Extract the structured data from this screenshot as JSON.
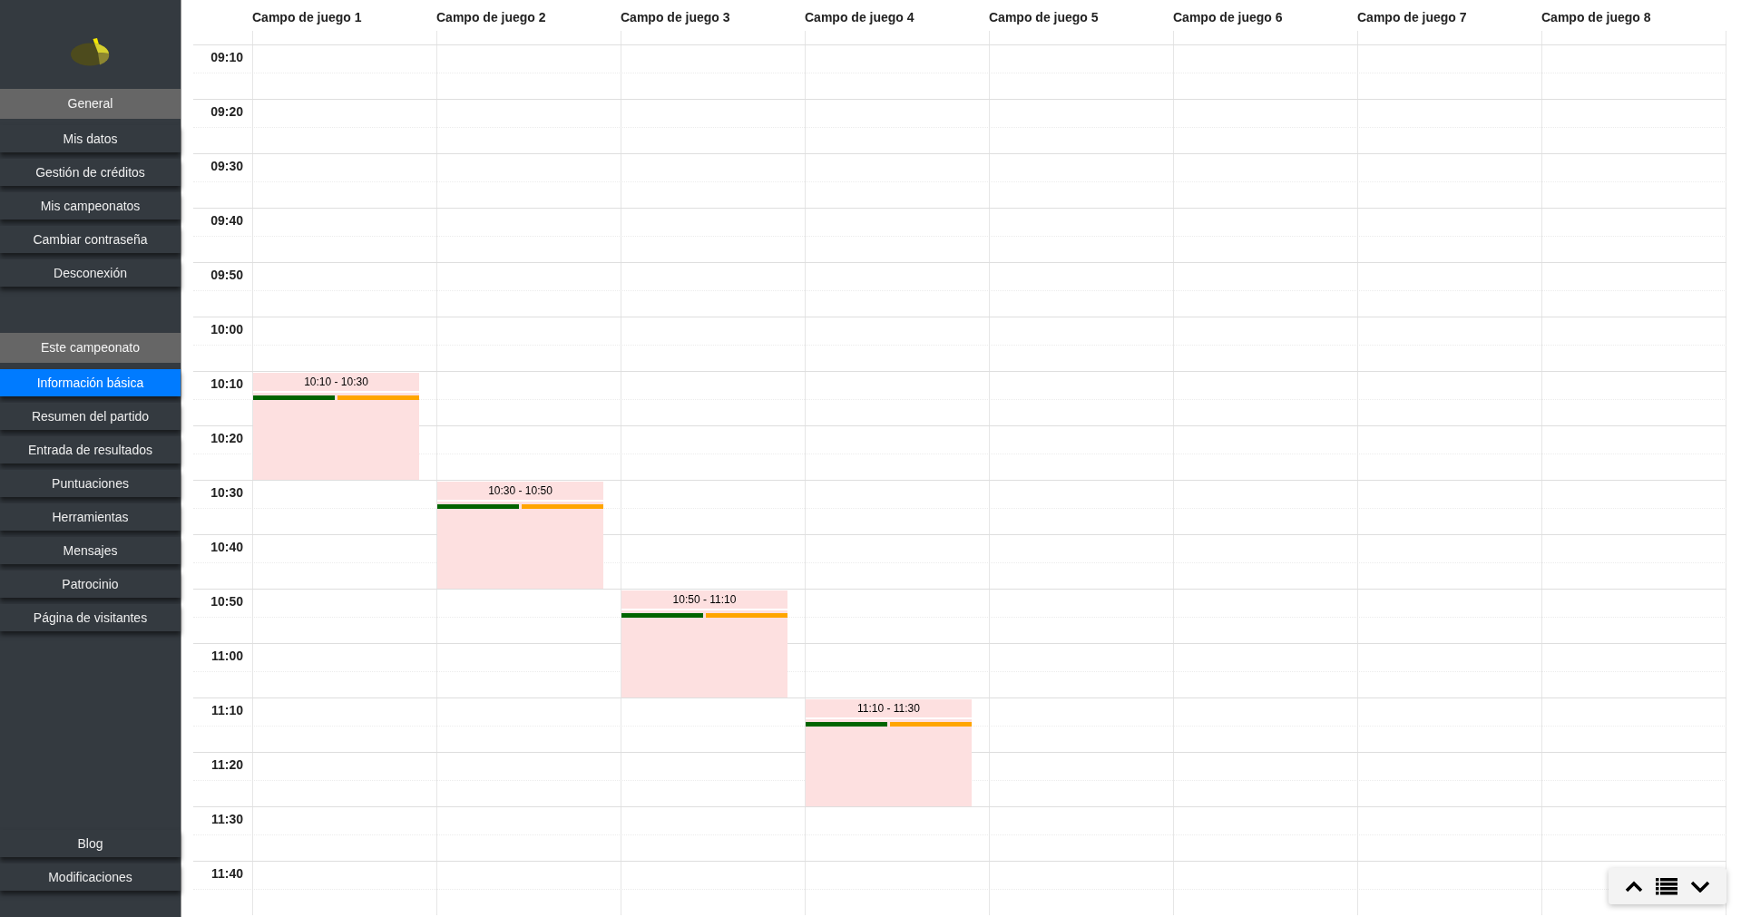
{
  "sidebar": {
    "sections": [
      {
        "heading": "General",
        "items": [
          {
            "label": "Mis datos",
            "selected": false
          },
          {
            "label": "Gestión de créditos",
            "selected": false
          },
          {
            "label": "Mis campeonatos",
            "selected": false
          },
          {
            "label": "Cambiar contraseña",
            "selected": false
          },
          {
            "label": "Desconexión",
            "selected": false
          }
        ]
      },
      {
        "heading": "Este campeonato",
        "items": [
          {
            "label": "Información básica",
            "selected": true
          },
          {
            "label": "Resumen del partido",
            "selected": false
          },
          {
            "label": "Entrada de resultados",
            "selected": false
          },
          {
            "label": "Puntuaciones",
            "selected": false
          },
          {
            "label": "Herramientas",
            "selected": false
          },
          {
            "label": "Mensajes",
            "selected": false
          },
          {
            "label": "Patrocinio",
            "selected": false
          },
          {
            "label": "Página de visitantes",
            "selected": false
          }
        ]
      }
    ],
    "footer_items": [
      {
        "label": "Blog",
        "selected": false
      },
      {
        "label": "Modificaciones",
        "selected": false
      }
    ]
  },
  "schedule": {
    "columns": [
      "Campo de juego 1",
      "Campo de juego 2",
      "Campo de juego 3",
      "Campo de juego 4",
      "Campo de juego 5",
      "Campo de juego 6",
      "Campo de juego 7",
      "Campo de juego 8"
    ],
    "rows": [
      {
        "time": "09:10"
      },
      {
        "time": "09:20"
      },
      {
        "time": "09:30"
      },
      {
        "time": "09:40"
      },
      {
        "time": "09:50"
      },
      {
        "time": "10:00"
      },
      {
        "time": "10:10",
        "cells": [
          {
            "kind": "match",
            "time": "10:10 - 10:30",
            "color_bars": [
              {
                "color": "#006400"
              },
              {
                "color": "#ffa500"
              }
            ]
          },
          {
            "kind": "empty"
          },
          {
            "kind": "empty"
          },
          {
            "kind": "empty"
          },
          {
            "kind": "empty"
          },
          {
            "kind": "empty"
          },
          {
            "kind": "empty"
          },
          {
            "kind": "empty"
          }
        ]
      },
      {
        "time": "10:20",
        "cells": [
          {
            "kind": "covered"
          },
          {
            "kind": "empty"
          },
          {
            "kind": "empty"
          },
          {
            "kind": "empty"
          },
          {
            "kind": "empty"
          },
          {
            "kind": "empty"
          },
          {
            "kind": "empty"
          },
          {
            "kind": "empty"
          }
        ]
      },
      {
        "time": "10:30",
        "cells": [
          {
            "kind": "empty"
          },
          {
            "kind": "match",
            "time": "10:30 - 10:50",
            "color_bars": [
              {
                "color": "#006400"
              },
              {
                "color": "#ffa500"
              }
            ]
          },
          {
            "kind": "empty"
          },
          {
            "kind": "empty"
          },
          {
            "kind": "empty"
          },
          {
            "kind": "empty"
          },
          {
            "kind": "empty"
          },
          {
            "kind": "empty"
          }
        ]
      },
      {
        "time": "10:40",
        "cells": [
          {
            "kind": "empty"
          },
          {
            "kind": "covered"
          },
          {
            "kind": "empty"
          },
          {
            "kind": "empty"
          },
          {
            "kind": "empty"
          },
          {
            "kind": "empty"
          },
          {
            "kind": "empty"
          },
          {
            "kind": "empty"
          }
        ]
      },
      {
        "time": "10:50",
        "cells": [
          {
            "kind": "empty"
          },
          {
            "kind": "empty"
          },
          {
            "kind": "match",
            "time": "10:50 - 11:10",
            "color_bars": [
              {
                "color": "#006400"
              },
              {
                "color": "#ffa500"
              }
            ]
          },
          {
            "kind": "empty"
          },
          {
            "kind": "empty"
          },
          {
            "kind": "empty"
          },
          {
            "kind": "empty"
          },
          {
            "kind": "empty"
          }
        ]
      },
      {
        "time": "11:00",
        "cells": [
          {
            "kind": "empty"
          },
          {
            "kind": "empty"
          },
          {
            "kind": "covered"
          },
          {
            "kind": "empty"
          },
          {
            "kind": "empty"
          },
          {
            "kind": "empty"
          },
          {
            "kind": "empty"
          },
          {
            "kind": "empty"
          }
        ]
      },
      {
        "time": "11:10",
        "cells": [
          {
            "kind": "empty"
          },
          {
            "kind": "empty"
          },
          {
            "kind": "empty"
          },
          {
            "kind": "match",
            "time": "11:10 - 11:30",
            "color_bars": [
              {
                "color": "#006400"
              },
              {
                "color": "#ffa500"
              }
            ]
          },
          {
            "kind": "empty"
          },
          {
            "kind": "empty"
          },
          {
            "kind": "empty"
          },
          {
            "kind": "empty"
          }
        ]
      },
      {
        "time": "11:20",
        "cells": [
          {
            "kind": "empty"
          },
          {
            "kind": "empty"
          },
          {
            "kind": "empty"
          },
          {
            "kind": "covered"
          },
          {
            "kind": "empty"
          },
          {
            "kind": "empty"
          },
          {
            "kind": "empty"
          },
          {
            "kind": "empty"
          }
        ]
      },
      {
        "time": "11:30"
      },
      {
        "time": "11:40"
      }
    ]
  }
}
